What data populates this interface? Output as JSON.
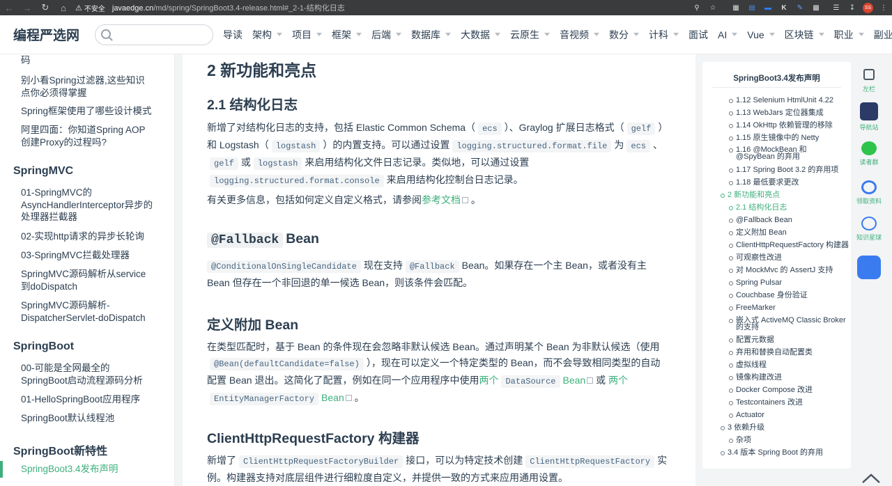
{
  "browser": {
    "security_label": "不安全",
    "url_host": "javaedge.cn",
    "url_path": "/md/spring/SpringBoot3.4-release.html#_2-1-结构化日志",
    "profile_initials": "SS"
  },
  "header": {
    "site_title": "编程严选网",
    "search_placeholder": "",
    "nav": [
      "导读",
      "架构",
      "项目",
      "框架",
      "后端",
      "数据库",
      "大数据",
      "云原生",
      "音视频",
      "数分",
      "计科",
      "面试",
      "AI",
      "Vue",
      "区块链",
      "职业",
      "副业"
    ],
    "nav_has_caret": [
      false,
      true,
      true,
      true,
      true,
      true,
      true,
      true,
      true,
      true,
      true,
      false,
      true,
      true,
      true,
      true,
      false
    ]
  },
  "sidebar": {
    "top_fragment": "码",
    "items_a": [
      "别小看Spring过滤器,这些知识点你必须得掌握",
      "Spring框架使用了哪些设计模式",
      "阿里四面：你知道Spring AOP创建Proxy的过程吗?"
    ],
    "group_springmvc": "SpringMVC",
    "items_mvc": [
      "01-SpringMVC的AsyncHandlerInterceptor异步的处理器拦截器",
      "02-实现http请求的异步长轮询",
      "03-SpringMVC拦截处理器",
      "SpringMVC源码解析从service到doDispatch",
      "SpringMVC源码解析-DispatcherServlet-doDispatch"
    ],
    "group_springboot": "SpringBoot",
    "items_boot": [
      "00-可能是全网最全的SpringBoot启动流程源码分析",
      "01-HelloSpringBoot应用程序",
      "SpringBoot默认线程池"
    ],
    "group_new": "SpringBoot新特性",
    "active_item": "SpringBoot3.4发布声明"
  },
  "content": {
    "h2": "2 新功能和亮点",
    "h3_logging": "2.1 结构化日志",
    "p1": {
      "t1": "新增了对结构化日志的支持，包括 Elastic Common Schema（",
      "c1": "ecs",
      "t2": "）、Graylog 扩展日志格式（",
      "c2": "gelf",
      "t3": "）和 Logstash（",
      "c3": "logstash",
      "t4": "）的内置支持。可以通过设置",
      "c4": "logging.structured.format.file",
      "t5": "为",
      "c5": "ecs",
      "t6": "、",
      "c6": "gelf",
      "t7": "或",
      "c7": "logstash",
      "t8": "来启用结构化文件日志记录。类似地，可以通过设置",
      "c8": "logging.structured.format.console",
      "t9": "来启用结构化控制台日志记录。"
    },
    "p2": {
      "t1": "有关更多信息，包括如何定义自定义格式，请参阅",
      "link": "参考文档",
      "t2": "。"
    },
    "h3_fallback": {
      "code": "@Fallback",
      "text": "Bean"
    },
    "p3": {
      "c1": "@ConditionalOnSingleCandidate",
      "t1": "现在支持",
      "c2": "@Fallback",
      "t2": "Bean。如果存在一个主 Bean，或者没有主 Bean 但存在一个非回退的单一候选 Bean，则该条件会匹配。"
    },
    "h3_additional": "定义附加 Bean",
    "p4": {
      "t1": "在类型匹配时，基于 Bean 的条件现在会忽略非默认候选 Bean。通过声明某个 Bean 为非默认候选（使用",
      "c1": "@Bean(defaultCandidate=false)",
      "t2": "），现在可以定义一个特定类型的 Bean，而不会导致相同类型的自动配置 Bean 退出。这简化了配置，例如在同一个应用程序中使用",
      "link1": "两个",
      "c2": "DataSource",
      "link1b": "Bean",
      "t3": "或",
      "link2": "两个",
      "c3": "EntityManagerFactory",
      "link2b": "Bean",
      "t4": "。"
    },
    "h3_client": "ClientHttpRequestFactory 构建器",
    "p5": {
      "t1": "新增了",
      "c1": "ClientHttpRequestFactoryBuilder",
      "t2": "接口，可以为特定技术创建",
      "c2": "ClientHttpRequestFactory",
      "t3": "实例。构建器支持对底层组件进行细粒度自定义，并提供一致的方式来应用通用设置。"
    }
  },
  "toc": {
    "title": "SpringBoot3.4发布声明",
    "items": [
      "1.12 Selenium HtmlUnit 4.22",
      "1.13 WebJars 定位器集成",
      "1.14 OkHttp 依赖管理的移除",
      "1.15 原生镜像中的 Netty",
      "1.16 @MockBean 和 @SpyBean 的弃用",
      "1.17 Spring Boot 3.2 的弃用项",
      "1.18 最低要求更改",
      "2 新功能和亮点",
      "2.1 结构化日志",
      "@Fallback Bean",
      "定义附加 Bean",
      "ClientHttpRequestFactory 构建器",
      "可观察性改进",
      "对 MockMvc 的 AssertJ 支持",
      "Spring Pulsar",
      "Couchbase 身份验证",
      "FreeMarker",
      "嵌入式 ActiveMQ Classic Broker 的支持",
      "配置元数据",
      "弃用和替换自动配置类",
      "虚拟线程",
      "镜像构建改进",
      "Docker Compose 改进",
      "Testcontainers 改进",
      "Actuator",
      "3 依赖升级",
      "杂项",
      "3.4 版本 Spring Boot 的弃用"
    ]
  },
  "rail": {
    "left_sidebar": "左栏",
    "nav_station": "导航站",
    "reader_group": "读者群",
    "get_materials": "领取资料",
    "knowledge_planet": "知识星球"
  },
  "colors": {
    "accent": "#3eaf7c",
    "text": "#2c3e50",
    "code_bg": "#f3f4f5",
    "code_text": "#476582"
  }
}
